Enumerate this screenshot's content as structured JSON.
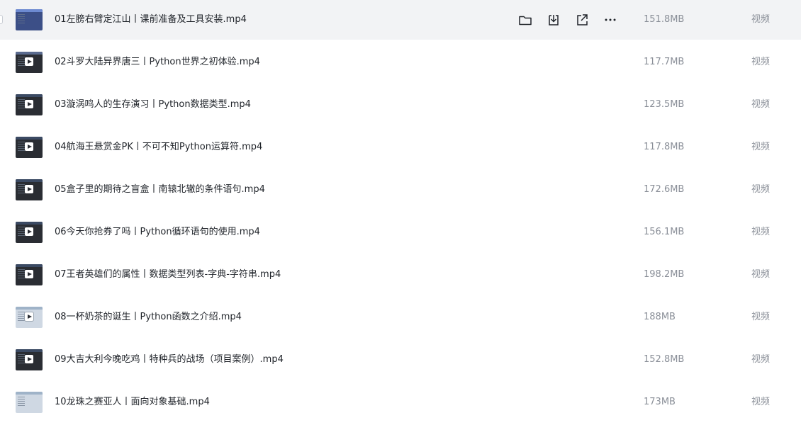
{
  "files": [
    {
      "name": "01左膀右臂定江山丨课前准备及工具安装.mp4",
      "size": "151.8MB",
      "type": "视频"
    },
    {
      "name": "02斗罗大陆异界唐三丨Python世界之初体验.mp4",
      "size": "117.7MB",
      "type": "视频"
    },
    {
      "name": "03漩涡鸣人的生存演习丨Python数据类型.mp4",
      "size": "123.5MB",
      "type": "视频"
    },
    {
      "name": "04航海王悬赏金PK丨不可不知Python运算符.mp4",
      "size": "117.8MB",
      "type": "视频"
    },
    {
      "name": "05盒子里的期待之盲盒丨南辕北辙的条件语句.mp4",
      "size": "172.6MB",
      "type": "视频"
    },
    {
      "name": "06今天你抢券了吗丨Python循环语句的使用.mp4",
      "size": "156.1MB",
      "type": "视频"
    },
    {
      "name": "07王者英雄们的属性丨数据类型列表-字典-字符串.mp4",
      "size": "198.2MB",
      "type": "视频"
    },
    {
      "name": "08一杯奶茶的诞生丨Python函数之介绍.mp4",
      "size": "188MB",
      "type": "视频"
    },
    {
      "name": "09大吉大利今晚吃鸡丨特种兵的战场（项目案例）.mp4",
      "size": "152.8MB",
      "type": "视频"
    },
    {
      "name": "10龙珠之赛亚人丨面向对象基础.mp4",
      "size": "173MB",
      "type": "视频"
    }
  ],
  "row_actions": {
    "icons": [
      "folder-icon",
      "download-icon",
      "share-icon",
      "more-icon"
    ]
  }
}
